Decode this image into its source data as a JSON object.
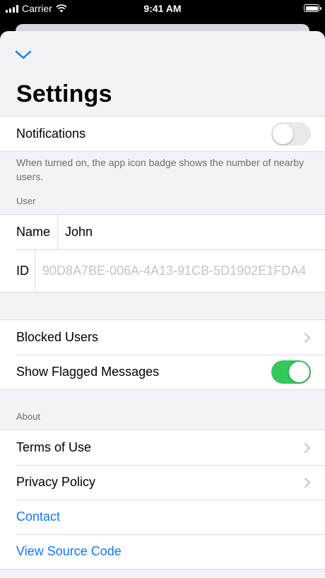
{
  "status_bar": {
    "carrier": "Carrier",
    "time": "9:41 AM"
  },
  "title": "Settings",
  "notifications": {
    "label": "Notifications",
    "enabled": false,
    "footer": "When turned on, the app icon badge shows the number of nearby users."
  },
  "user_section": {
    "header": "User",
    "name_label": "Name",
    "name_value": "John",
    "id_label": "ID",
    "id_value": "90D8A7BE-006A-4A13-91CB-5D1902E1FDA4"
  },
  "moderation": {
    "blocked_users": "Blocked Users",
    "show_flagged": "Show Flagged Messages",
    "show_flagged_enabled": true
  },
  "about_section": {
    "header": "About",
    "terms": "Terms of Use",
    "privacy": "Privacy Policy",
    "contact": "Contact",
    "source_code": "View Source Code"
  },
  "colors": {
    "accent": "#0a7aff",
    "toggle_on": "#34c759",
    "toggle_off": "#e9e9ea",
    "background": "#f2f2f7"
  },
  "icons": [
    "signal-icon",
    "wifi-icon",
    "battery-icon",
    "chevron-down-icon",
    "chevron-right-icon"
  ]
}
